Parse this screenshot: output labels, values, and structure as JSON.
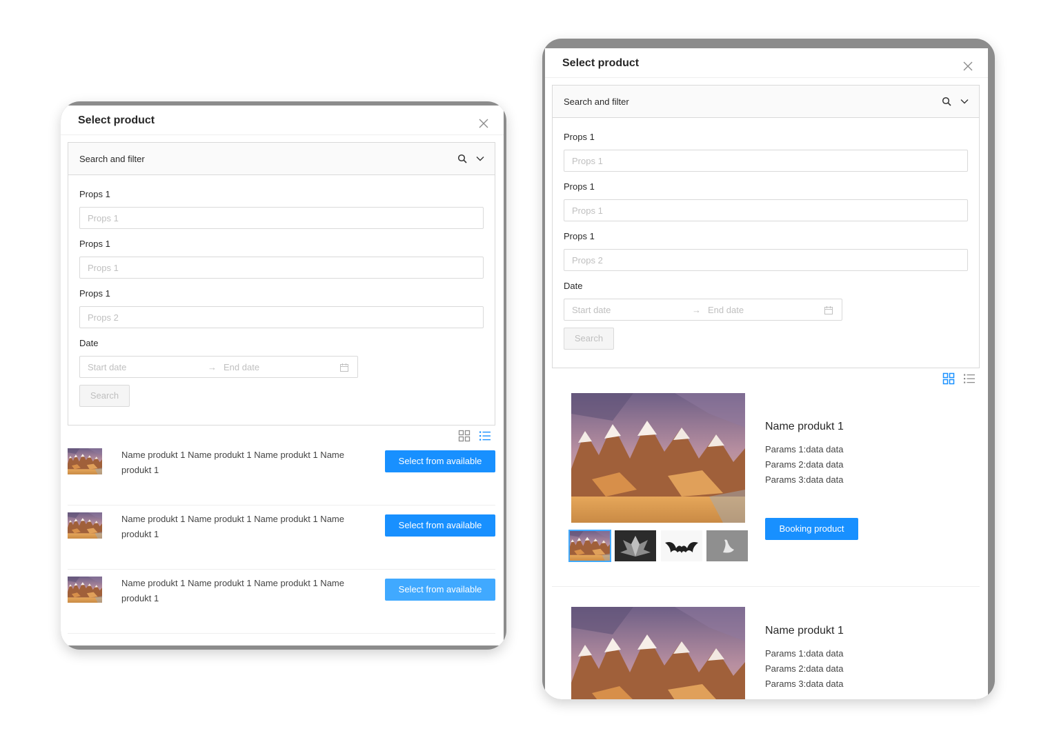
{
  "colors": {
    "primary": "#1890ff",
    "primary_light": "#40a9ff",
    "border": "#d9d9d9",
    "placeholder": "#bfbfbf",
    "device_frame": "#8c8c8c"
  },
  "modal": {
    "title": "Select product"
  },
  "filter": {
    "title": "Search and filter",
    "fields": [
      {
        "label": "Props 1",
        "placeholder": "Props 1"
      },
      {
        "label": "Props 1",
        "placeholder": "Props 1"
      },
      {
        "label": "Props 1",
        "placeholder": "Props 2"
      }
    ],
    "date": {
      "label": "Date",
      "start_placeholder": "Start date",
      "arrow": "→",
      "end_placeholder": "End date"
    },
    "search_label": "Search"
  },
  "list_view": {
    "active_view": "list",
    "items": [
      {
        "name": "Name produkt 1 Name produkt 1 Name produkt 1 Name produkt 1",
        "button": "Select from available"
      },
      {
        "name": "Name produkt 1 Name produkt 1 Name produkt 1 Name produkt 1",
        "button": "Select from available"
      },
      {
        "name": "Name produkt 1 Name produkt 1 Name produkt 1 Name produkt 1",
        "button": "Select from available"
      }
    ]
  },
  "grid_view": {
    "active_view": "grid",
    "products": [
      {
        "name": "Name produkt 1",
        "params": [
          "Params 1:data data",
          "Params 2:data data",
          "Params 3:data data"
        ],
        "button": "Booking product"
      },
      {
        "name": "Name produkt 1",
        "params": [
          "Params 1:data data",
          "Params 2:data data",
          "Params 3:data data"
        ]
      }
    ],
    "thumbnails": [
      "mountains-thumbnail",
      "leaf-sculpture-thumbnail",
      "bat-silhouette-thumbnail",
      "bird-figure-thumbnail"
    ]
  }
}
